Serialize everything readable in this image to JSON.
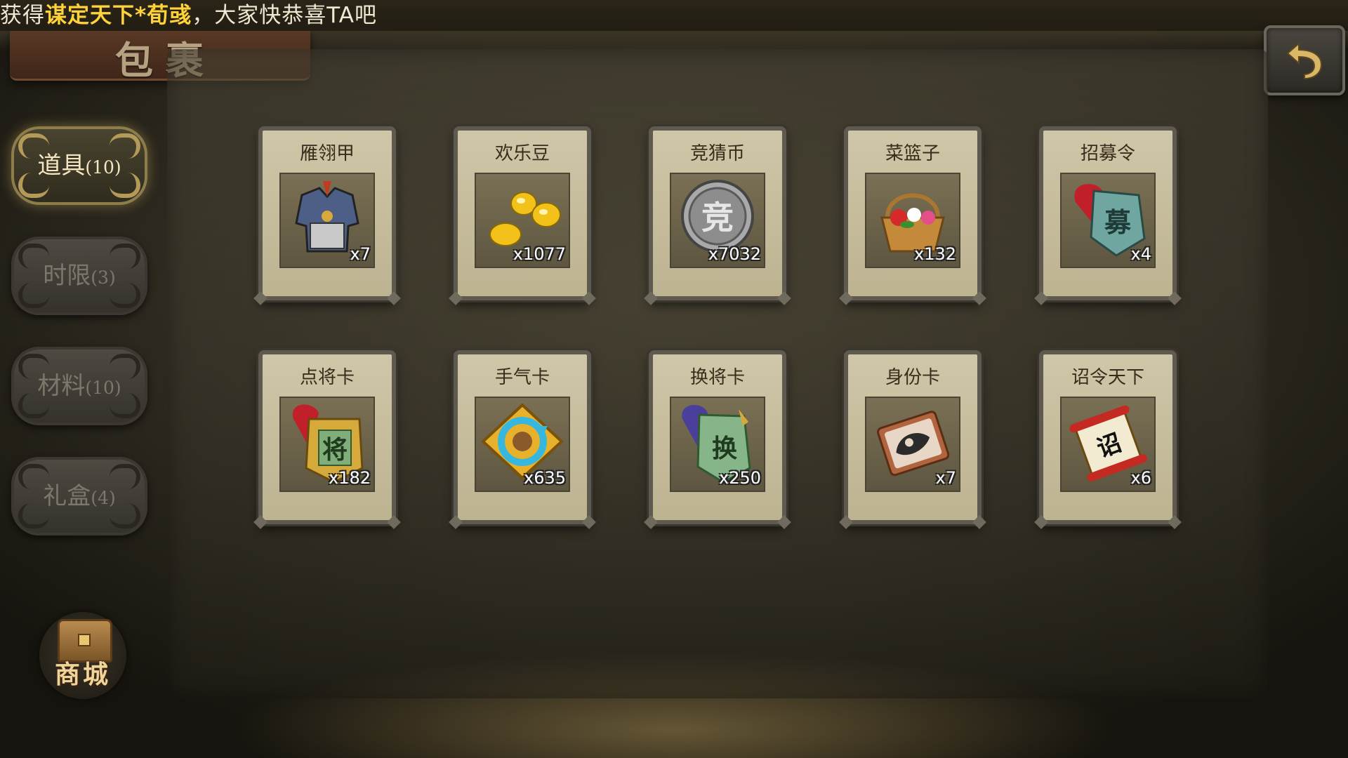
{
  "marquee": {
    "prefix": "获得",
    "highlight": "谋定天下*荀彧",
    "suffix": "，大家快恭喜TA吧"
  },
  "title": "包裹",
  "tabs": [
    {
      "label": "道具",
      "count": "(10)",
      "active": true
    },
    {
      "label": "时限",
      "count": "(3)",
      "active": false
    },
    {
      "label": "材料",
      "count": "(10)",
      "active": false
    },
    {
      "label": "礼盒",
      "count": "(4)",
      "active": false
    }
  ],
  "shop": {
    "label": "商城",
    "icon": "treasure-chest-icon"
  },
  "back": {
    "icon": "back-arrow-icon"
  },
  "items": [
    {
      "name": "雁翎甲",
      "qty": "x7",
      "icon": "armor-icon"
    },
    {
      "name": "欢乐豆",
      "qty": "x1077",
      "icon": "gold-beans-icon"
    },
    {
      "name": "竞猜币",
      "qty": "x7032",
      "icon": "silver-coin-icon"
    },
    {
      "name": "菜篮子",
      "qty": "x132",
      "icon": "flower-basket-icon"
    },
    {
      "name": "招募令",
      "qty": "x4",
      "icon": "recruit-token-icon"
    },
    {
      "name": "点将卡",
      "qty": "x182",
      "icon": "general-card-icon"
    },
    {
      "name": "手气卡",
      "qty": "x635",
      "icon": "luck-card-icon"
    },
    {
      "name": "换将卡",
      "qty": "x250",
      "icon": "swap-card-icon"
    },
    {
      "name": "身份卡",
      "qty": "x7",
      "icon": "identity-card-icon"
    },
    {
      "name": "诏令天下",
      "qty": "x6",
      "icon": "imperial-scroll-icon"
    }
  ],
  "icon_text": {
    "coin": "竞",
    "token": "募",
    "general": "将",
    "swap": "换",
    "scroll": "诏"
  },
  "colors": {
    "highlight": "#ffd23a",
    "card": "#cfc6a8",
    "active_tab_glow": "#b49a58"
  }
}
